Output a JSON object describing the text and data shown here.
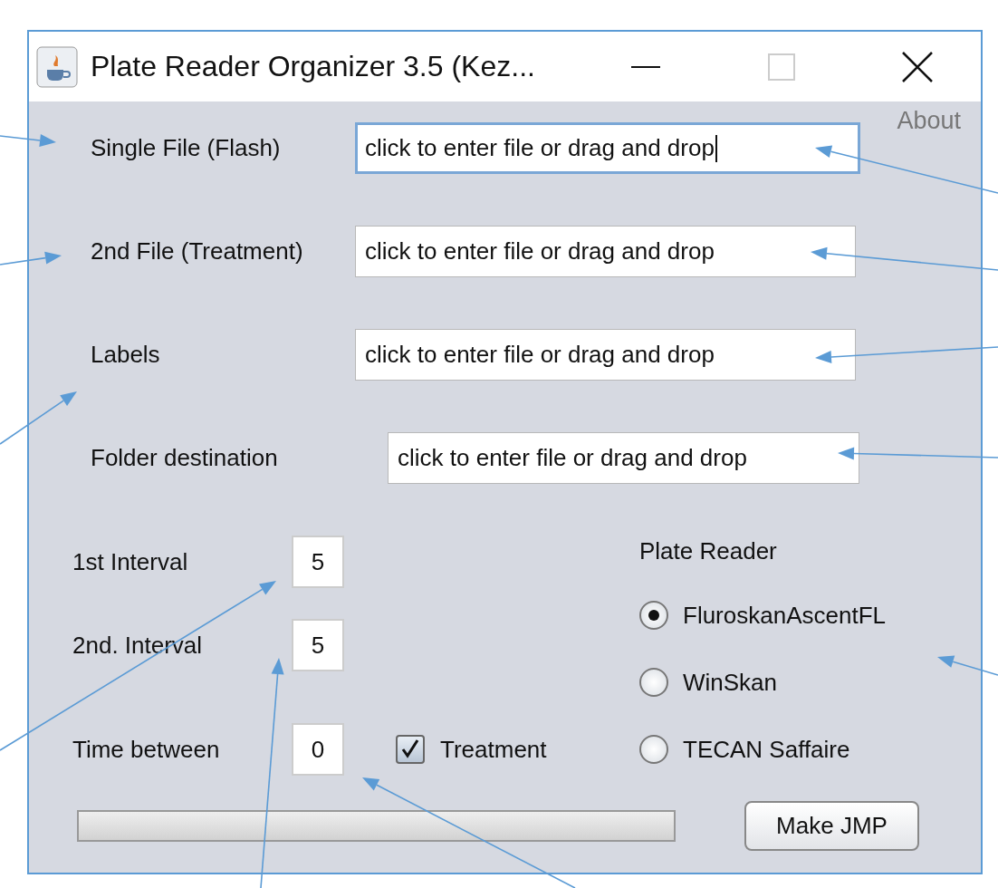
{
  "window": {
    "title": "Plate Reader Organizer 3.5 (Kez..."
  },
  "about": "About",
  "file_fields": [
    {
      "label": "Single File (Flash)",
      "value": "click to enter file or drag and drop",
      "focused": true
    },
    {
      "label": "2nd File (Treatment)",
      "value": "click to enter file or drag and drop",
      "focused": false
    },
    {
      "label": "Labels",
      "value": "click to enter file or drag and drop",
      "focused": false
    },
    {
      "label": "Folder destination",
      "value": "click to enter file or drag and drop",
      "focused": false
    }
  ],
  "intervals": [
    {
      "label": "1st Interval",
      "value": "5"
    },
    {
      "label": "2nd. Interval",
      "value": "5"
    },
    {
      "label": "Time between",
      "value": "0"
    }
  ],
  "treatment": {
    "label": "Treatment",
    "checked": true
  },
  "plate_reader": {
    "title": "Plate Reader",
    "options": [
      {
        "label": "FluroskanAscentFL",
        "selected": true
      },
      {
        "label": "WinSkan",
        "selected": false
      },
      {
        "label": "TECAN Saffaire",
        "selected": false
      }
    ]
  },
  "progress": {
    "level": 0
  },
  "make_button": "Make JMP"
}
